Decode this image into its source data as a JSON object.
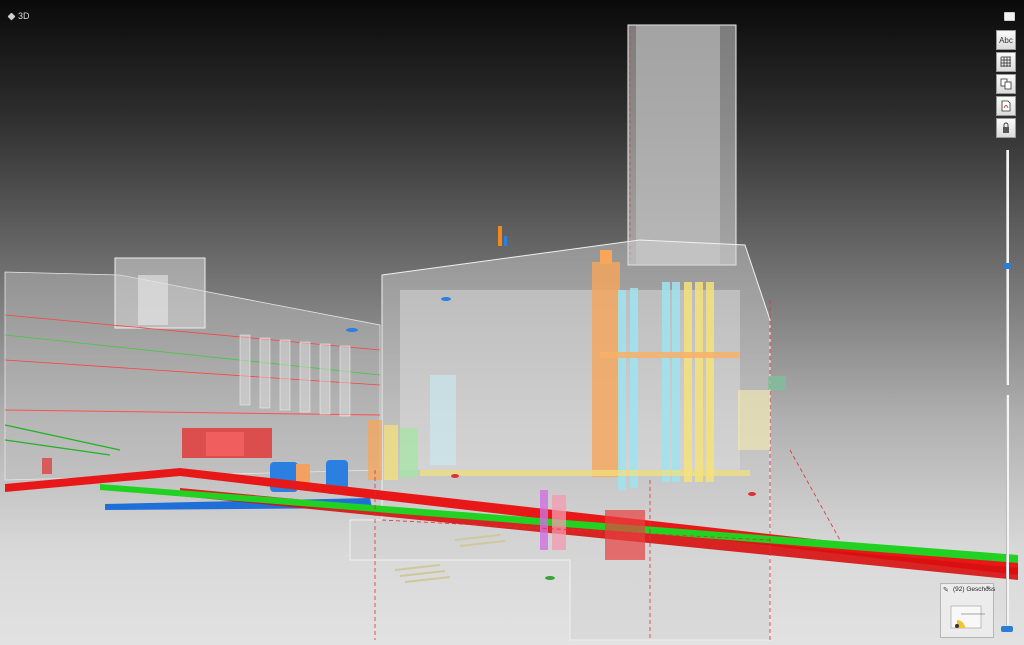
{
  "view": {
    "label": "3D"
  },
  "toolbar": {
    "items": [
      {
        "name": "text-annotation",
        "label": "Abc"
      },
      {
        "name": "grid",
        "label": ""
      },
      {
        "name": "compare",
        "label": ""
      },
      {
        "name": "pdf-export",
        "label": ""
      },
      {
        "name": "lock",
        "label": ""
      }
    ]
  },
  "minimap": {
    "title": "(92) Geschoss",
    "close_glyph": "×"
  },
  "colors": {
    "pipe_red": "#e81818",
    "pipe_green": "#22d222",
    "pipe_blue": "#1f6fd8",
    "duct_orange": "#f7a65a",
    "duct_yellow": "#f4e27a",
    "duct_cyan": "#9fe3ef",
    "accent_blue": "#2a7fd4"
  }
}
